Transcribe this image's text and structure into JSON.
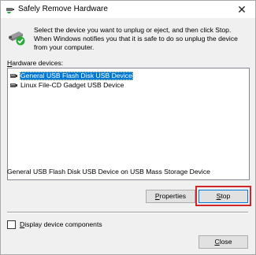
{
  "window": {
    "title": "Safely Remove Hardware",
    "close_glyph": "✕"
  },
  "intro": {
    "text": "Select the device you want to unplug or eject, and then click Stop. When Windows notifies you that it is safe to do so unplug the device from your computer."
  },
  "hardware": {
    "label_access_key": "H",
    "label_rest": "ardware devices:",
    "items": [
      {
        "label": "General USB Flash Disk USB Device",
        "selected": true
      },
      {
        "label": "Linux File-CD Gadget USB Device",
        "selected": false
      }
    ]
  },
  "status": {
    "text": "General USB Flash Disk USB Device on USB Mass Storage Device"
  },
  "buttons": {
    "properties_access_key": "P",
    "properties_rest": "roperties",
    "stop_access_key": "S",
    "stop_rest": "top",
    "close_access_key": "C",
    "close_rest": "lose"
  },
  "display_components": {
    "access_key": "D",
    "rest": "isplay device components",
    "checked": false
  },
  "colors": {
    "selection": "#0078d7",
    "highlight_box": "#d0262a",
    "check_green": "#2aa83a"
  },
  "icons": {
    "title": "usb-drive-icon",
    "device": "usb-eject-check-icon",
    "list_item": "usb-device-icon"
  }
}
